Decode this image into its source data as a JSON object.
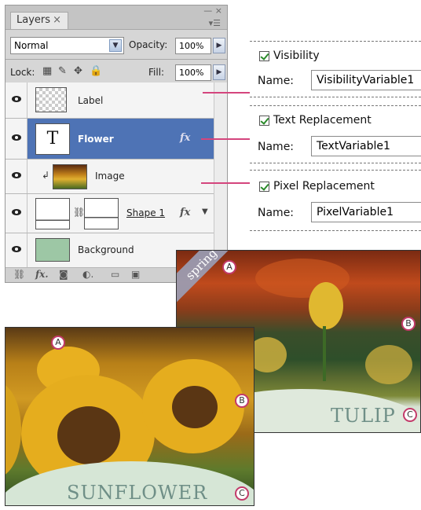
{
  "layers_panel": {
    "tab_label": "Layers",
    "tab_close": "×",
    "window_controls": "— ×",
    "blend_mode": "Normal",
    "opacity_label": "Opacity:",
    "opacity_value": "100%",
    "lock_label": "Lock:",
    "fill_label": "Fill:",
    "fill_value": "100%",
    "layers": [
      {
        "name": "Label",
        "type": "transparent",
        "selected": false,
        "fx": ""
      },
      {
        "name": "Flower",
        "type": "text",
        "thumb_glyph": "T",
        "selected": true,
        "fx": "fx"
      },
      {
        "name": "Image",
        "type": "image",
        "selected": false,
        "fx": ""
      },
      {
        "name": "Shape 1",
        "type": "shape",
        "selected": false,
        "fx": "fx"
      },
      {
        "name": "Background",
        "type": "fill",
        "selected": false,
        "fx": ""
      }
    ],
    "bottom_icons": [
      "link-icon",
      "fx-icon",
      "mask-icon",
      "adjustment-icon",
      "folder-icon",
      "new-layer-icon"
    ]
  },
  "variables": [
    {
      "checkbox_label": "Visibility",
      "checked": true,
      "name_label": "Name:",
      "name_value": "VisibilityVariable1"
    },
    {
      "checkbox_label": "Text Replacement",
      "checked": true,
      "name_label": "Name:",
      "name_value": "TextVariable1"
    },
    {
      "checkbox_label": "Pixel Replacement",
      "checked": true,
      "name_label": "Name:",
      "name_value": "PixelVariable1"
    }
  ],
  "tulip_photo": {
    "tag_text": "spring",
    "title": "TULIP",
    "callouts": {
      "a": "A",
      "b": "B",
      "c": "C"
    }
  },
  "sunflower_photo": {
    "title": "SUNFLOWER",
    "callouts": {
      "a": "A",
      "b": "B",
      "c": "C"
    }
  },
  "colors": {
    "selection": "#4e73b5",
    "leader": "#d4457d",
    "background_layer": "#9dc7a5",
    "photo_title": "#6f8f87"
  }
}
